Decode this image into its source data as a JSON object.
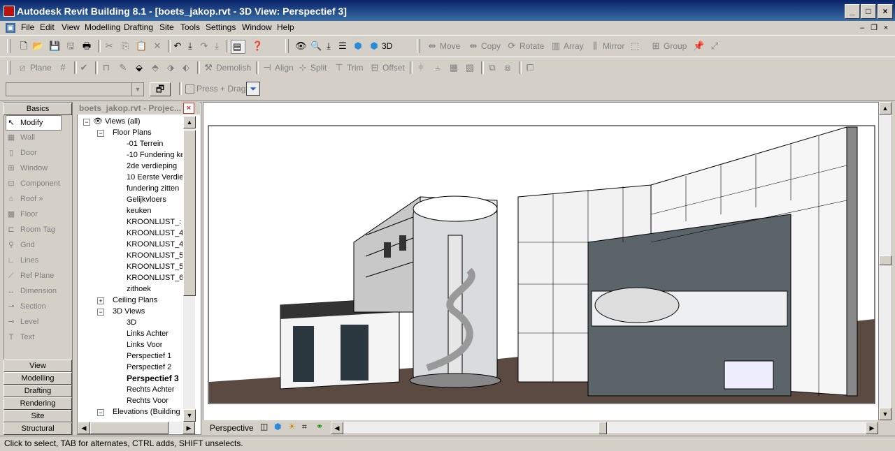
{
  "window": {
    "title": "Autodesk Revit Building 8.1 - [boets_jakop.rvt - 3D View: Perspectief 3]"
  },
  "menu": [
    "File",
    "Edit",
    "View",
    "Modelling",
    "Drafting",
    "Site",
    "Tools",
    "Settings",
    "Window",
    "Help"
  ],
  "toolbar1": {
    "view3d_label": "3D",
    "move": "Move",
    "copy": "Copy",
    "rotate": "Rotate",
    "array": "Array",
    "mirror": "Mirror",
    "group": "Group"
  },
  "toolbar2": {
    "plane": "Plane",
    "demolish": "Demolish",
    "align": "Align",
    "split": "Split",
    "trim": "Trim",
    "offset": "Offset"
  },
  "options": {
    "press_drag": "Press + Drag"
  },
  "design_bar": {
    "tab_top": "Basics",
    "items": [
      "Modify",
      "Wall",
      "Door",
      "Window",
      "Component",
      "Roof »",
      "Floor",
      "Room Tag",
      "Grid",
      "Lines",
      "Ref Plane",
      "Dimension",
      "Section",
      "Level",
      "Text"
    ],
    "tabs_bottom": [
      "View",
      "Modelling",
      "Drafting",
      "Rendering",
      "Site",
      "Structural"
    ]
  },
  "browser": {
    "title": "boets_jakop.rvt - Projec...",
    "root": "Views (all)",
    "floor_plans": "Floor Plans",
    "floor_items": [
      "-01 Terrein",
      "-10 Fundering ke",
      "2de verdieping",
      "10 Eerste Verdie",
      "fundering zitten",
      "Gelijkvloers",
      "keuken",
      "KROONLIJST_:",
      "KROONLIJST_4",
      "KROONLIJST_4",
      "KROONLIJST_5",
      "KROONLIJST_5",
      "KROONLIJST_6",
      "zithoek"
    ],
    "ceiling_plans": "Ceiling Plans",
    "views_3d": "3D Views",
    "views3d_items": [
      "3D",
      "Links Achter",
      "Links Voor",
      "Perspectief 1",
      "Perspectief 2",
      "Perspectief 3",
      "Rechts Achter",
      "Rechts Voor"
    ],
    "elevations": "Elevations (Building E"
  },
  "viewbar": {
    "mode": "Perspective"
  },
  "status": "Click to select, TAB for alternates, CTRL adds, SHIFT unselects.",
  "colors": {
    "titlebar": "#0a246a",
    "face": "#d4d0c8",
    "ground": "#5a4a42"
  }
}
